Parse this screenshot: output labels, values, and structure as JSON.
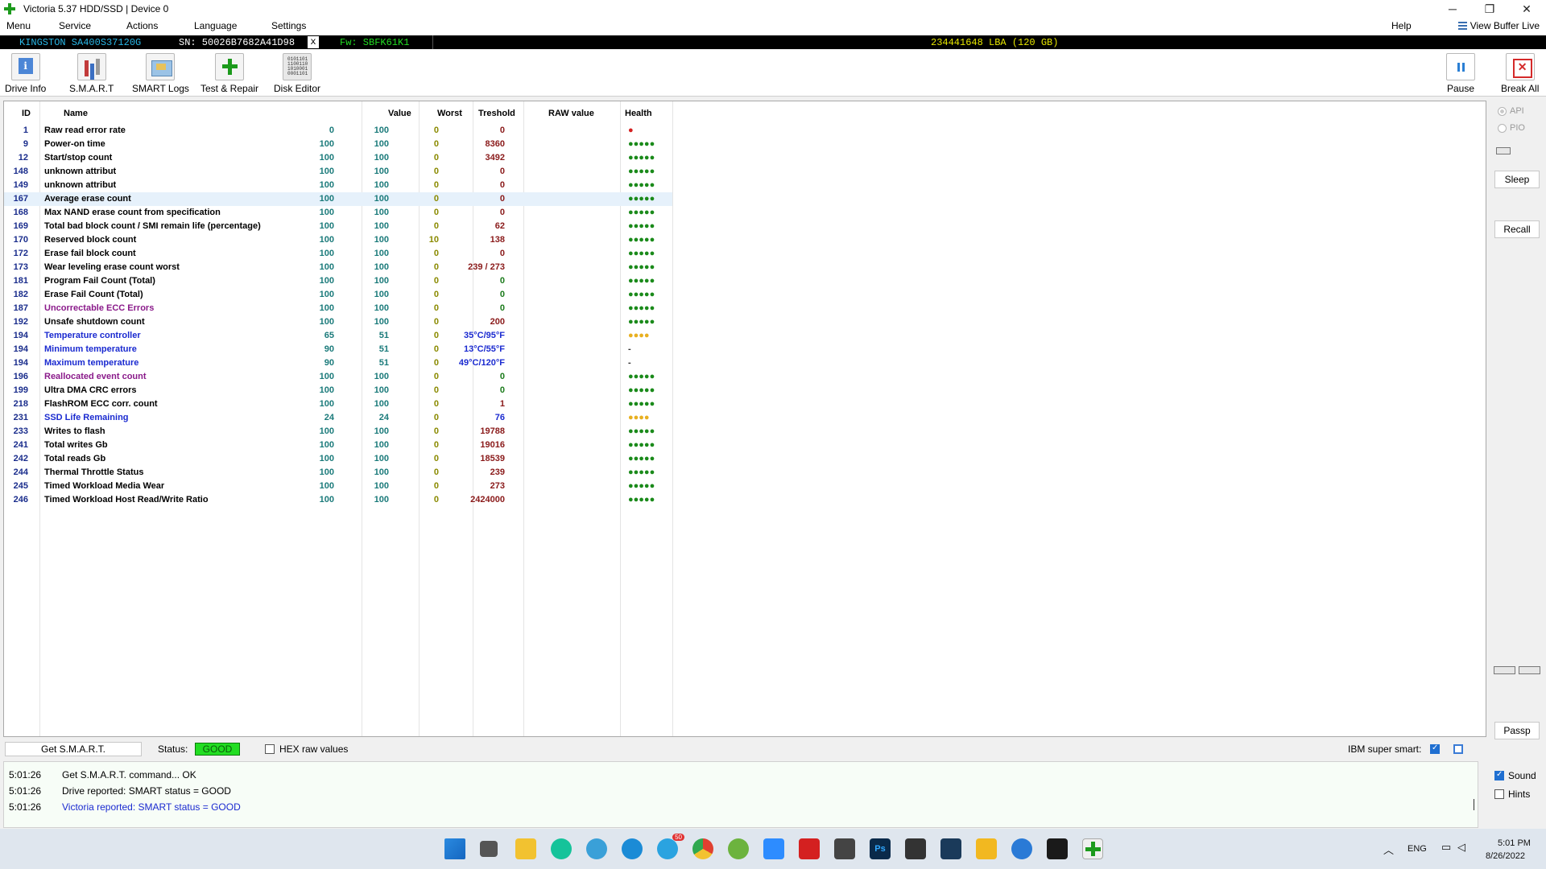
{
  "window": {
    "title": "Victoria 5.37 HDD/SSD | Device 0",
    "controls": {
      "minimize": "─",
      "maximize": "❐",
      "close": "✕"
    }
  },
  "menu": {
    "items": [
      "Menu",
      "Service",
      "Actions",
      "Language",
      "Settings"
    ],
    "help": "Help",
    "view_buffer": "View Buffer Live"
  },
  "device": {
    "model": "KINGSTON SA400S37120G",
    "serial": "SN: 50026B7682A41D98",
    "close_x": "x",
    "firmware": "Fw: SBFK61K1",
    "capacity": "234441648 LBA (120 GB)"
  },
  "toolbar": {
    "drive_info": "Drive Info",
    "smart": "S.M.A.R.T",
    "smart_logs": "SMART Logs",
    "test_repair": "Test & Repair",
    "disk_editor": "Disk Editor",
    "pause": "Pause",
    "break_all": "Break All"
  },
  "table": {
    "headers": {
      "id": "ID",
      "name": "Name",
      "value": "Value",
      "worst": "Worst",
      "treshold": "Treshold",
      "raw": "RAW value",
      "health": "Health"
    },
    "rows": [
      {
        "id": "1",
        "name": "Raw read error rate",
        "value": "0",
        "worst": "100",
        "treshold": "0",
        "raw": "0",
        "health": "●",
        "name_color": "#000000",
        "health_color": "#d42020"
      },
      {
        "id": "9",
        "name": "Power-on time",
        "value": "100",
        "worst": "100",
        "treshold": "0",
        "raw": "8360",
        "health": "●●●●●",
        "name_color": "#000000",
        "health_color": "#1a8a1a"
      },
      {
        "id": "12",
        "name": "Start/stop count",
        "value": "100",
        "worst": "100",
        "treshold": "0",
        "raw": "3492",
        "health": "●●●●●",
        "name_color": "#000000",
        "health_color": "#1a8a1a"
      },
      {
        "id": "148",
        "name": "unknown attribut",
        "value": "100",
        "worst": "100",
        "treshold": "0",
        "raw": "0",
        "health": "●●●●●",
        "name_color": "#000000",
        "health_color": "#1a8a1a"
      },
      {
        "id": "149",
        "name": "unknown attribut",
        "value": "100",
        "worst": "100",
        "treshold": "0",
        "raw": "0",
        "health": "●●●●●",
        "name_color": "#000000",
        "health_color": "#1a8a1a"
      },
      {
        "id": "167",
        "name": "Average erase count",
        "value": "100",
        "worst": "100",
        "treshold": "0",
        "raw": "0",
        "health": "●●●●●",
        "name_color": "#000000",
        "health_color": "#1a8a1a"
      },
      {
        "id": "168",
        "name": "Max NAND erase count from specification",
        "value": "100",
        "worst": "100",
        "treshold": "0",
        "raw": "0",
        "health": "●●●●●",
        "name_color": "#000000",
        "health_color": "#1a8a1a"
      },
      {
        "id": "169",
        "name": "Total bad block count / SMI remain life (percentage)",
        "value": "100",
        "worst": "100",
        "treshold": "0",
        "raw": "62",
        "health": "●●●●●",
        "name_color": "#000000",
        "health_color": "#1a8a1a"
      },
      {
        "id": "170",
        "name": "Reserved block count",
        "value": "100",
        "worst": "100",
        "treshold": "10",
        "raw": "138",
        "health": "●●●●●",
        "name_color": "#000000",
        "health_color": "#1a8a1a"
      },
      {
        "id": "172",
        "name": "Erase fail block count",
        "value": "100",
        "worst": "100",
        "treshold": "0",
        "raw": "0",
        "health": "●●●●●",
        "name_color": "#000000",
        "health_color": "#1a8a1a"
      },
      {
        "id": "173",
        "name": "Wear leveling erase count worst",
        "value": "100",
        "worst": "100",
        "treshold": "0",
        "raw": "239 / 273",
        "health": "●●●●●",
        "name_color": "#000000",
        "health_color": "#1a8a1a"
      },
      {
        "id": "181",
        "name": "Program Fail Count (Total)",
        "value": "100",
        "worst": "100",
        "treshold": "0",
        "raw": "0",
        "health": "●●●●●",
        "name_color": "#000000",
        "health_color": "#1a8a1a",
        "raw_color": "#1a7a1a"
      },
      {
        "id": "182",
        "name": "Erase Fail Count (Total)",
        "value": "100",
        "worst": "100",
        "treshold": "0",
        "raw": "0",
        "health": "●●●●●",
        "name_color": "#000000",
        "health_color": "#1a8a1a",
        "raw_color": "#1a7a1a"
      },
      {
        "id": "187",
        "name": "Uncorrectable ECC Errors",
        "value": "100",
        "worst": "100",
        "treshold": "0",
        "raw": "0",
        "health": "●●●●●",
        "name_color": "#8a1a8a",
        "health_color": "#1a8a1a",
        "raw_color": "#1a7a1a"
      },
      {
        "id": "192",
        "name": "Unsafe shutdown count",
        "value": "100",
        "worst": "100",
        "treshold": "0",
        "raw": "200",
        "health": "●●●●●",
        "name_color": "#000000",
        "health_color": "#1a8a1a"
      },
      {
        "id": "194",
        "name": "Temperature controller",
        "value": "65",
        "worst": "51",
        "treshold": "0",
        "raw": "35°C/95°F",
        "health": "●●●●",
        "name_color": "#1a2ad0",
        "health_color": "#e8b020",
        "raw_color": "#1a2ad0"
      },
      {
        "id": "194",
        "name": "Minimum temperature",
        "value": "90",
        "worst": "51",
        "treshold": "0",
        "raw": "13°C/55°F",
        "health": "-",
        "name_color": "#1a2ad0",
        "health_color": "#333333",
        "raw_color": "#1a2ad0"
      },
      {
        "id": "194",
        "name": "Maximum temperature",
        "value": "90",
        "worst": "51",
        "treshold": "0",
        "raw": "49°C/120°F",
        "health": "-",
        "name_color": "#1a2ad0",
        "health_color": "#333333",
        "raw_color": "#1a2ad0"
      },
      {
        "id": "196",
        "name": "Reallocated event count",
        "value": "100",
        "worst": "100",
        "treshold": "0",
        "raw": "0",
        "health": "●●●●●",
        "name_color": "#8a1a8a",
        "health_color": "#1a8a1a",
        "raw_color": "#1a7a1a"
      },
      {
        "id": "199",
        "name": "Ultra DMA CRC errors",
        "value": "100",
        "worst": "100",
        "treshold": "0",
        "raw": "0",
        "health": "●●●●●",
        "name_color": "#000000",
        "health_color": "#1a8a1a",
        "raw_color": "#1a7a1a"
      },
      {
        "id": "218",
        "name": "FlashROM ECC corr. count",
        "value": "100",
        "worst": "100",
        "treshold": "0",
        "raw": "1",
        "health": "●●●●●",
        "name_color": "#000000",
        "health_color": "#1a8a1a"
      },
      {
        "id": "231",
        "name": "SSD Life Remaining",
        "value": "24",
        "worst": "24",
        "treshold": "0",
        "raw": "76",
        "health": "●●●●",
        "name_color": "#1a2ad0",
        "health_color": "#e8b020",
        "raw_color": "#1a2ad0"
      },
      {
        "id": "233",
        "name": "Writes to flash",
        "value": "100",
        "worst": "100",
        "treshold": "0",
        "raw": "19788",
        "health": "●●●●●",
        "name_color": "#000000",
        "health_color": "#1a8a1a"
      },
      {
        "id": "241",
        "name": "Total writes Gb",
        "value": "100",
        "worst": "100",
        "treshold": "0",
        "raw": "19016",
        "health": "●●●●●",
        "name_color": "#000000",
        "health_color": "#1a8a1a"
      },
      {
        "id": "242",
        "name": "Total reads Gb",
        "value": "100",
        "worst": "100",
        "treshold": "0",
        "raw": "18539",
        "health": "●●●●●",
        "name_color": "#000000",
        "health_color": "#1a8a1a"
      },
      {
        "id": "244",
        "name": "Thermal Throttle Status",
        "value": "100",
        "worst": "100",
        "treshold": "0",
        "raw": "239",
        "health": "●●●●●",
        "name_color": "#000000",
        "health_color": "#1a8a1a"
      },
      {
        "id": "245",
        "name": "Timed Workload Media Wear",
        "value": "100",
        "worst": "100",
        "treshold": "0",
        "raw": "273",
        "health": "●●●●●",
        "name_color": "#000000",
        "health_color": "#1a8a1a"
      },
      {
        "id": "246",
        "name": "Timed Workload Host Read/Write Ratio",
        "value": "100",
        "worst": "100",
        "treshold": "0",
        "raw": "2424000",
        "health": "●●●●●",
        "name_color": "#000000",
        "health_color": "#1a8a1a"
      }
    ],
    "highlighted_row": 5
  },
  "right_panel": {
    "api": "API",
    "pio": "PIO",
    "sleep": "Sleep",
    "recall": "Recall",
    "passp": "Passp"
  },
  "status": {
    "get_smart": "Get S.M.A.R.T.",
    "status_label": "Status:",
    "status_value": "GOOD",
    "hex_raw": "HEX raw values",
    "hex_checked": false,
    "ibm_super_smart": "IBM super smart:",
    "ibm_checked": true
  },
  "log": [
    {
      "time": "5:01:26",
      "text": "Get S.M.A.R.T. command... OK",
      "color": "#000000"
    },
    {
      "time": "5:01:26",
      "text": "Drive reported: SMART status = GOOD",
      "color": "#000000"
    },
    {
      "time": "5:01:26",
      "text": "Victoria reported: SMART status = GOOD",
      "color": "#1a2ad0"
    }
  ],
  "log_options": {
    "sound": "Sound",
    "sound_checked": true,
    "hints": "Hints",
    "hints_checked": false
  },
  "taskbar": {
    "apps": [
      "start-icon",
      "task-view-icon",
      "file-explorer-icon",
      "grammarly-icon",
      "browser-icon",
      "edge-icon",
      "telegram-icon",
      "chrome-icon",
      "utorrent-icon",
      "zoom-icon",
      "acrobat-icon",
      "calculator-icon",
      "photoshop-icon",
      "davinci-icon",
      "vpn-icon",
      "notes-icon",
      "screen-recorder-icon",
      "terminal-icon",
      "victoria-icon"
    ],
    "telegram_badge": "50",
    "lang": "ENG",
    "time": "5:01 PM",
    "date": "8/26/2022"
  }
}
